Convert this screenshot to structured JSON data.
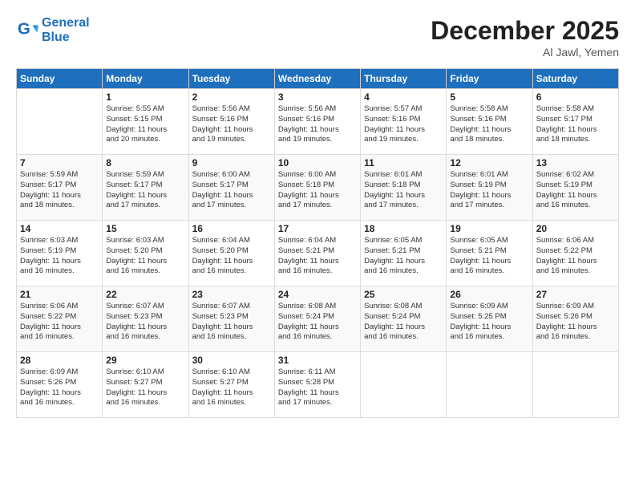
{
  "header": {
    "logo_line1": "General",
    "logo_line2": "Blue",
    "month": "December 2025",
    "location": "Al Jawl, Yemen"
  },
  "days_of_week": [
    "Sunday",
    "Monday",
    "Tuesday",
    "Wednesday",
    "Thursday",
    "Friday",
    "Saturday"
  ],
  "weeks": [
    [
      {
        "num": "",
        "info": ""
      },
      {
        "num": "1",
        "info": "Sunrise: 5:55 AM\nSunset: 5:15 PM\nDaylight: 11 hours\nand 20 minutes."
      },
      {
        "num": "2",
        "info": "Sunrise: 5:56 AM\nSunset: 5:16 PM\nDaylight: 11 hours\nand 19 minutes."
      },
      {
        "num": "3",
        "info": "Sunrise: 5:56 AM\nSunset: 5:16 PM\nDaylight: 11 hours\nand 19 minutes."
      },
      {
        "num": "4",
        "info": "Sunrise: 5:57 AM\nSunset: 5:16 PM\nDaylight: 11 hours\nand 19 minutes."
      },
      {
        "num": "5",
        "info": "Sunrise: 5:58 AM\nSunset: 5:16 PM\nDaylight: 11 hours\nand 18 minutes."
      },
      {
        "num": "6",
        "info": "Sunrise: 5:58 AM\nSunset: 5:17 PM\nDaylight: 11 hours\nand 18 minutes."
      }
    ],
    [
      {
        "num": "7",
        "info": "Sunrise: 5:59 AM\nSunset: 5:17 PM\nDaylight: 11 hours\nand 18 minutes."
      },
      {
        "num": "8",
        "info": "Sunrise: 5:59 AM\nSunset: 5:17 PM\nDaylight: 11 hours\nand 17 minutes."
      },
      {
        "num": "9",
        "info": "Sunrise: 6:00 AM\nSunset: 5:17 PM\nDaylight: 11 hours\nand 17 minutes."
      },
      {
        "num": "10",
        "info": "Sunrise: 6:00 AM\nSunset: 5:18 PM\nDaylight: 11 hours\nand 17 minutes."
      },
      {
        "num": "11",
        "info": "Sunrise: 6:01 AM\nSunset: 5:18 PM\nDaylight: 11 hours\nand 17 minutes."
      },
      {
        "num": "12",
        "info": "Sunrise: 6:01 AM\nSunset: 5:19 PM\nDaylight: 11 hours\nand 17 minutes."
      },
      {
        "num": "13",
        "info": "Sunrise: 6:02 AM\nSunset: 5:19 PM\nDaylight: 11 hours\nand 16 minutes."
      }
    ],
    [
      {
        "num": "14",
        "info": "Sunrise: 6:03 AM\nSunset: 5:19 PM\nDaylight: 11 hours\nand 16 minutes."
      },
      {
        "num": "15",
        "info": "Sunrise: 6:03 AM\nSunset: 5:20 PM\nDaylight: 11 hours\nand 16 minutes."
      },
      {
        "num": "16",
        "info": "Sunrise: 6:04 AM\nSunset: 5:20 PM\nDaylight: 11 hours\nand 16 minutes."
      },
      {
        "num": "17",
        "info": "Sunrise: 6:04 AM\nSunset: 5:21 PM\nDaylight: 11 hours\nand 16 minutes."
      },
      {
        "num": "18",
        "info": "Sunrise: 6:05 AM\nSunset: 5:21 PM\nDaylight: 11 hours\nand 16 minutes."
      },
      {
        "num": "19",
        "info": "Sunrise: 6:05 AM\nSunset: 5:21 PM\nDaylight: 11 hours\nand 16 minutes."
      },
      {
        "num": "20",
        "info": "Sunrise: 6:06 AM\nSunset: 5:22 PM\nDaylight: 11 hours\nand 16 minutes."
      }
    ],
    [
      {
        "num": "21",
        "info": "Sunrise: 6:06 AM\nSunset: 5:22 PM\nDaylight: 11 hours\nand 16 minutes."
      },
      {
        "num": "22",
        "info": "Sunrise: 6:07 AM\nSunset: 5:23 PM\nDaylight: 11 hours\nand 16 minutes."
      },
      {
        "num": "23",
        "info": "Sunrise: 6:07 AM\nSunset: 5:23 PM\nDaylight: 11 hours\nand 16 minutes."
      },
      {
        "num": "24",
        "info": "Sunrise: 6:08 AM\nSunset: 5:24 PM\nDaylight: 11 hours\nand 16 minutes."
      },
      {
        "num": "25",
        "info": "Sunrise: 6:08 AM\nSunset: 5:24 PM\nDaylight: 11 hours\nand 16 minutes."
      },
      {
        "num": "26",
        "info": "Sunrise: 6:09 AM\nSunset: 5:25 PM\nDaylight: 11 hours\nand 16 minutes."
      },
      {
        "num": "27",
        "info": "Sunrise: 6:09 AM\nSunset: 5:26 PM\nDaylight: 11 hours\nand 16 minutes."
      }
    ],
    [
      {
        "num": "28",
        "info": "Sunrise: 6:09 AM\nSunset: 5:26 PM\nDaylight: 11 hours\nand 16 minutes."
      },
      {
        "num": "29",
        "info": "Sunrise: 6:10 AM\nSunset: 5:27 PM\nDaylight: 11 hours\nand 16 minutes."
      },
      {
        "num": "30",
        "info": "Sunrise: 6:10 AM\nSunset: 5:27 PM\nDaylight: 11 hours\nand 16 minutes."
      },
      {
        "num": "31",
        "info": "Sunrise: 6:11 AM\nSunset: 5:28 PM\nDaylight: 11 hours\nand 17 minutes."
      },
      {
        "num": "",
        "info": ""
      },
      {
        "num": "",
        "info": ""
      },
      {
        "num": "",
        "info": ""
      }
    ]
  ]
}
